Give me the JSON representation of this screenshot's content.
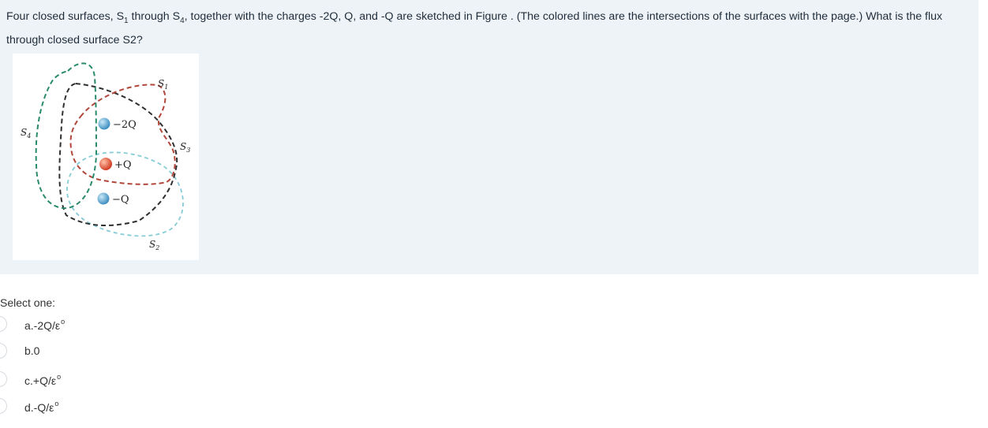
{
  "question": {
    "text_before_s1": "Four closed surfaces, S",
    "s1_sub": "1",
    "text_mid": " through S",
    "s4_sub": "4",
    "text_after": ", together with the charges -2Q, Q, and -Q are sketched in Figure . (The colored lines are the intersections of the surfaces with the page.) What is the flux through closed surface S2?"
  },
  "figure": {
    "labels": {
      "s1_main": "S",
      "s1_sub": "1",
      "s2_main": "S",
      "s2_sub": "2",
      "s3_main": "S",
      "s3_sub": "3",
      "s4_main": "S",
      "s4_sub": "4"
    },
    "charges": [
      {
        "label": "−2Q",
        "color": "#5aa3cf"
      },
      {
        "label": "+Q",
        "color": "#e4533a"
      },
      {
        "label": "−Q",
        "color": "#5aa3cf"
      }
    ],
    "colors": {
      "s1": "#b0473a",
      "s2": "#86cbd6",
      "s3": "#2f2f2f",
      "s4": "#2a8a6c"
    }
  },
  "answer": {
    "prompt": "Select one:",
    "options": [
      {
        "text": "a.-2Q/ε",
        "sup": "o"
      },
      {
        "text": "b.0",
        "sup": ""
      },
      {
        "text": "c.+Q/ε",
        "sup": "o"
      },
      {
        "text": "d.-Q/ε",
        "sup": "o"
      }
    ]
  }
}
